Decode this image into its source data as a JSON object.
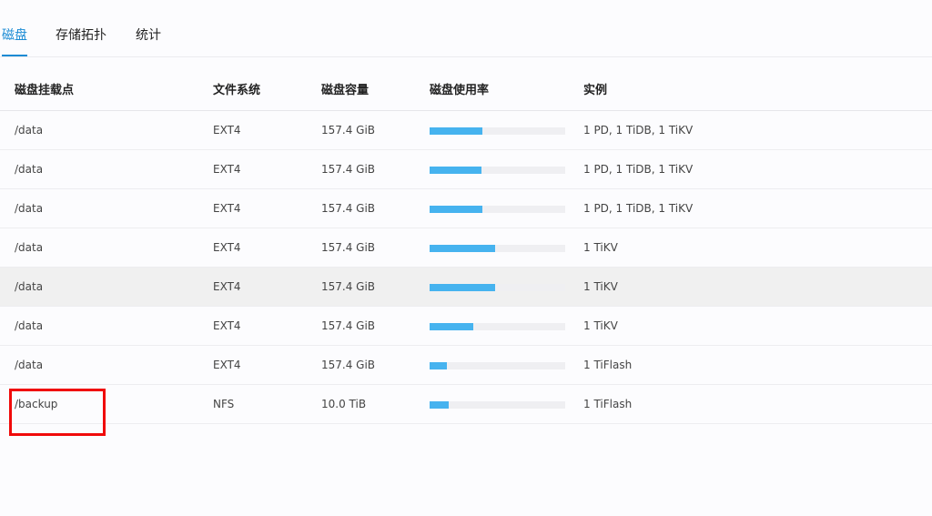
{
  "tabs": [
    {
      "label": "磁盘",
      "active": true
    },
    {
      "label": "存储拓扑",
      "active": false
    },
    {
      "label": "统计",
      "active": false
    }
  ],
  "table": {
    "columns": [
      "磁盘挂载点",
      "文件系统",
      "磁盘容量",
      "磁盘使用率",
      "实例"
    ],
    "rows": [
      {
        "mount": "/data",
        "fs": "EXT4",
        "capacity": "157.4 GiB",
        "usage_fraction": 0.39,
        "instances": "1 PD, 1 TiDB, 1 TiKV"
      },
      {
        "mount": "/data",
        "fs": "EXT4",
        "capacity": "157.4 GiB",
        "usage_fraction": 0.385,
        "instances": "1 PD, 1 TiDB, 1 TiKV"
      },
      {
        "mount": "/data",
        "fs": "EXT4",
        "capacity": "157.4 GiB",
        "usage_fraction": 0.39,
        "instances": "1 PD, 1 TiDB, 1 TiKV"
      },
      {
        "mount": "/data",
        "fs": "EXT4",
        "capacity": "157.4 GiB",
        "usage_fraction": 0.485,
        "instances": "1 TiKV"
      },
      {
        "mount": "/data",
        "fs": "EXT4",
        "capacity": "157.4 GiB",
        "usage_fraction": 0.485,
        "instances": "1 TiKV",
        "hovered": true
      },
      {
        "mount": "/data",
        "fs": "EXT4",
        "capacity": "157.4 GiB",
        "usage_fraction": 0.325,
        "instances": "1 TiKV"
      },
      {
        "mount": "/data",
        "fs": "EXT4",
        "capacity": "157.4 GiB",
        "usage_fraction": 0.13,
        "instances": "1 TiFlash"
      },
      {
        "mount": "/backup",
        "fs": "NFS",
        "capacity": "10.0 TiB",
        "usage_fraction": 0.14,
        "instances": "1 TiFlash"
      }
    ]
  },
  "colors": {
    "accent": "#1b8bd4",
    "bar_fill": "#46b3ef",
    "bar_track": "#efeff2",
    "annotation": "#f00a0a"
  }
}
